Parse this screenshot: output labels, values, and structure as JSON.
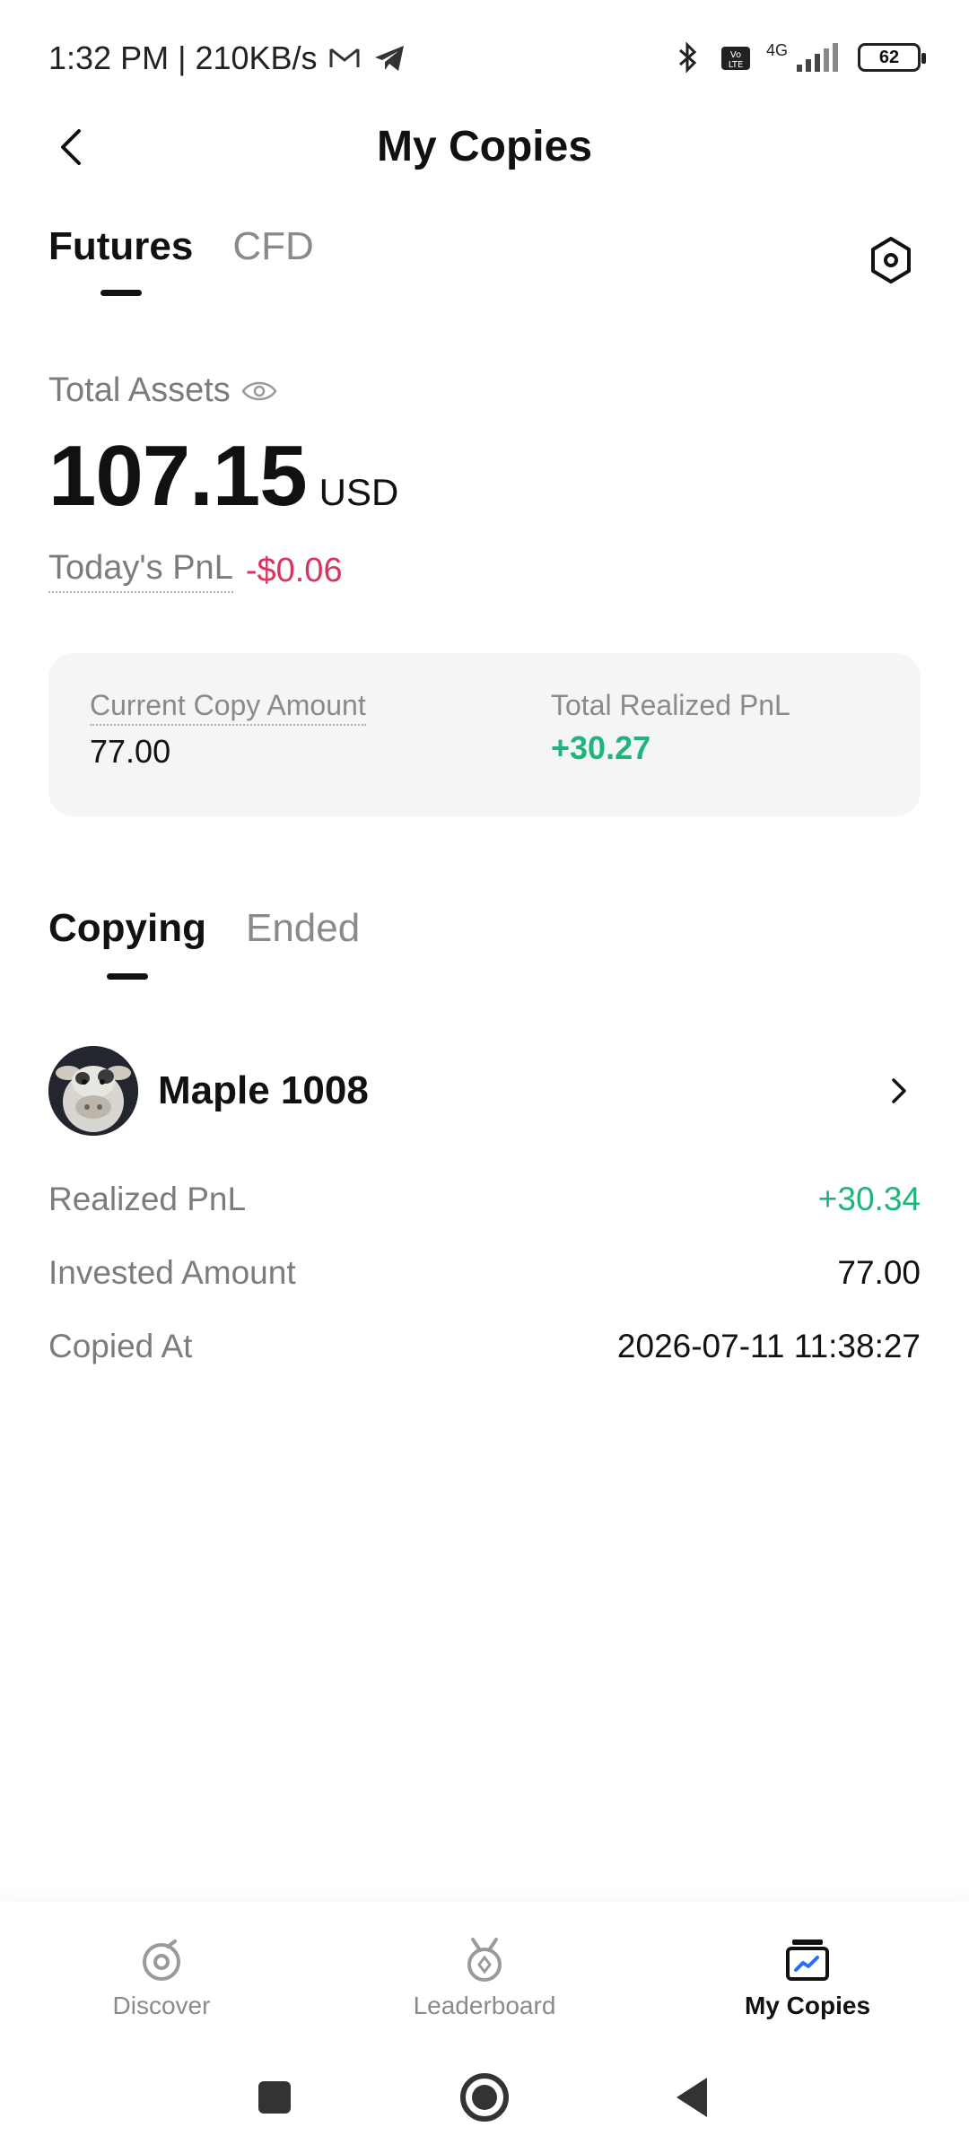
{
  "status_bar": {
    "time": "1:32 PM",
    "separator": "|",
    "speed": "210KB/s",
    "network": "4G",
    "battery": "62"
  },
  "header": {
    "title": "My Copies"
  },
  "top_tabs": {
    "items": [
      {
        "label": "Futures",
        "active": true
      },
      {
        "label": "CFD",
        "active": false
      }
    ]
  },
  "assets": {
    "label": "Total Assets",
    "value": "107.15",
    "currency": "USD",
    "pnl_label": "Today's PnL",
    "pnl_value": "-$0.06"
  },
  "summary": {
    "copy_amount_label": "Current Copy Amount",
    "copy_amount_value": "77.00",
    "realized_label": "Total Realized PnL",
    "realized_value": "+30.27"
  },
  "copy_tabs": {
    "items": [
      {
        "label": "Copying",
        "active": true
      },
      {
        "label": "Ended",
        "active": false
      }
    ]
  },
  "trader": {
    "name": "Maple 1008",
    "details": [
      {
        "label": "Realized PnL",
        "value": "+30.34",
        "positive": true
      },
      {
        "label": "Invested Amount",
        "value": "77.00"
      },
      {
        "label": "Copied At",
        "value": "2026-07-11 11:38:27"
      }
    ]
  },
  "bottom_nav": {
    "items": [
      {
        "label": "Discover",
        "icon": "discover-icon",
        "active": false
      },
      {
        "label": "Leaderboard",
        "icon": "medal-icon",
        "active": false
      },
      {
        "label": "My Copies",
        "icon": "copies-icon",
        "active": true
      }
    ]
  },
  "colors": {
    "positive": "#1fb57a",
    "negative": "#d9345e",
    "card_bg": "#f4f5f7",
    "active_nav_accent": "#2b6ef6"
  }
}
